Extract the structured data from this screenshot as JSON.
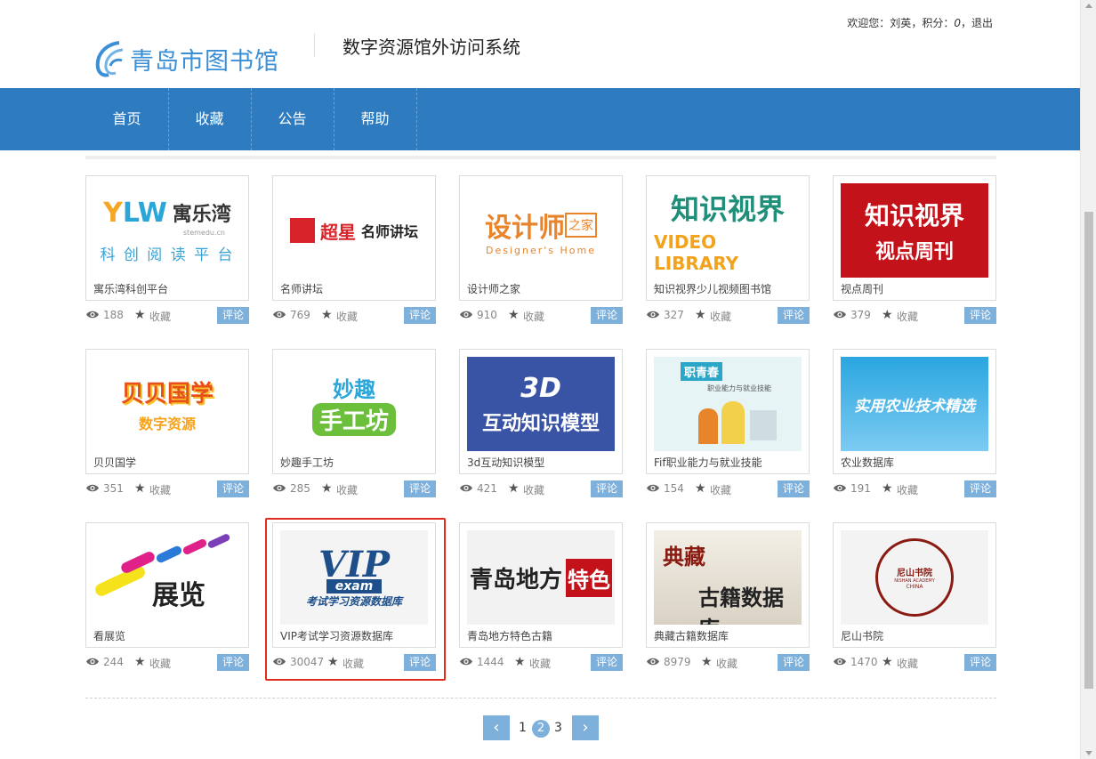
{
  "header": {
    "logo_text": "青岛市图书馆",
    "system_title": "数字资源馆外访问系统",
    "welcome": "欢迎您：",
    "username": "刘英",
    "points_label": "，积分：",
    "points": "0",
    "sep": "，",
    "logout": "退出"
  },
  "nav": {
    "items": [
      {
        "label": "首页"
      },
      {
        "label": "收藏"
      },
      {
        "label": "公告"
      },
      {
        "label": "帮助"
      }
    ]
  },
  "cards": [
    {
      "name": "寓乐湾科创平台",
      "views": "188",
      "fav": "收藏",
      "comment": "评论",
      "logo": "YLW",
      "logo2": "寓乐湾",
      "logo3": "stemedu.cn",
      "logo4": "科 创 阅 读 平 台"
    },
    {
      "name": "名师讲坛",
      "views": "769",
      "fav": "收藏",
      "comment": "评论",
      "logo": "超星",
      "logo2": "名师讲坛"
    },
    {
      "name": "设计师之家",
      "views": "910",
      "fav": "收藏",
      "comment": "评论",
      "logo": "设计师",
      "logo2": "之家",
      "logo3": "Designer's Home"
    },
    {
      "name": "知识视界少儿视频图书馆",
      "views": "327",
      "fav": "收藏",
      "comment": "评论",
      "logo": "知识视界",
      "logo2": "VIDEO LIBRARY"
    },
    {
      "name": "视点周刊",
      "views": "379",
      "fav": "收藏",
      "comment": "评论",
      "logo": "知识视界",
      "logo2": "视点周刊"
    },
    {
      "name": "贝贝国学",
      "views": "351",
      "fav": "收藏",
      "comment": "评论",
      "logo": "贝贝国学",
      "logo2": "数字资源"
    },
    {
      "name": "妙趣手工坊",
      "views": "285",
      "fav": "收藏",
      "comment": "评论",
      "logo": "妙趣",
      "logo2": "手工坊"
    },
    {
      "name": "3d互动知识模型",
      "views": "421",
      "fav": "收藏",
      "comment": "评论",
      "logo": "3D",
      "logo2": "互动知识模型"
    },
    {
      "name": "Fif职业能力与就业技能",
      "views": "154",
      "fav": "收藏",
      "comment": "评论",
      "logo": "职青春",
      "logo2": "职业能力与就业技能"
    },
    {
      "name": "农业数据库",
      "views": "191",
      "fav": "收藏",
      "comment": "评论",
      "logo": "实用农业技术精选"
    },
    {
      "name": "看展览",
      "views": "244",
      "fav": "收藏",
      "comment": "评论",
      "logo": "展览"
    },
    {
      "name": "VIP考试学习资源数据库",
      "views": "30047",
      "fav": "收藏",
      "comment": "评论",
      "logo": "VIP",
      "logo2": "exam",
      "logo3": "考试学习资源数据库"
    },
    {
      "name": "青岛地方特色古籍",
      "views": "1444",
      "fav": "收藏",
      "comment": "评论",
      "logo": "青岛地方",
      "logo2": "特色"
    },
    {
      "name": "典藏古籍数据库",
      "views": "8979",
      "fav": "收藏",
      "comment": "评论",
      "logo": "典藏",
      "logo2": "古籍数据库"
    },
    {
      "name": "尼山书院",
      "views": "1470",
      "fav": "收藏",
      "comment": "评论",
      "logo": "尼山书院",
      "logo2": "NISHAN ACADEMY",
      "logo3": "CHINA"
    }
  ],
  "pager": {
    "prev": "‹",
    "pages": [
      "1",
      "2",
      "3"
    ],
    "current": "2",
    "next": "›"
  },
  "colors": {
    "nav_bg": "#2e7bbf",
    "accent": "#7eb0dc",
    "highlight_border": "#e02b20"
  }
}
